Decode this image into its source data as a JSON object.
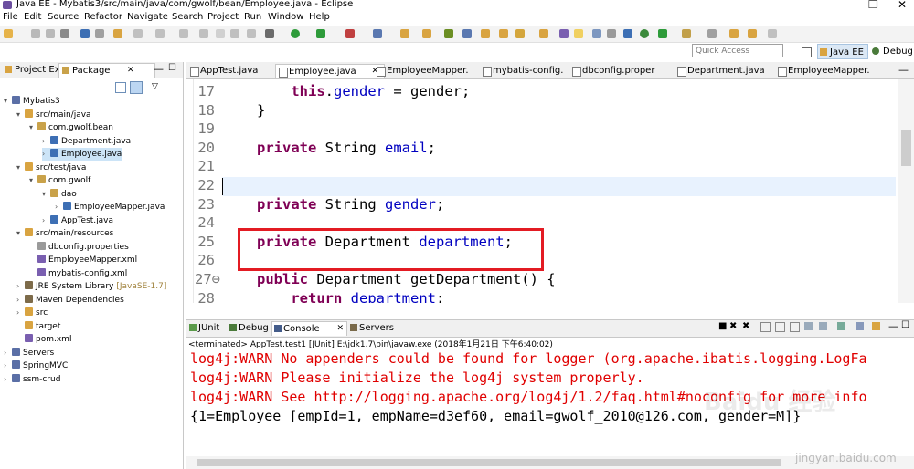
{
  "window": {
    "title": "Java EE - Mybatis3/src/main/java/com/gwolf/bean/Employee.java - Eclipse",
    "controls": [
      "—",
      "❐",
      "✕"
    ]
  },
  "menu": [
    "File",
    "Edit",
    "Source",
    "Refactor",
    "Navigate",
    "Search",
    "Project",
    "Run",
    "Window",
    "Help"
  ],
  "quick_access": {
    "placeholder": "Quick Access"
  },
  "perspectives": {
    "java_ee": "Java EE",
    "debug": "Debug"
  },
  "left_panel": {
    "tabs": [
      "Project Ex",
      "Package"
    ],
    "tree": [
      {
        "label": "Mybatis3",
        "level": 0,
        "arrow": "▾",
        "icon": "project"
      },
      {
        "label": "src/main/java",
        "level": 1,
        "arrow": "▾",
        "icon": "folder"
      },
      {
        "label": "com.gwolf.bean",
        "level": 2,
        "arrow": "▾",
        "icon": "package"
      },
      {
        "label": "Department.java",
        "level": 3,
        "arrow": "›",
        "icon": "java"
      },
      {
        "label": "Employee.java",
        "level": 3,
        "arrow": "›",
        "icon": "java",
        "selected": true
      },
      {
        "label": "src/test/java",
        "level": 1,
        "arrow": "▾",
        "icon": "folder"
      },
      {
        "label": "com.gwolf",
        "level": 2,
        "arrow": "▾",
        "icon": "package"
      },
      {
        "label": "dao",
        "level": 3,
        "arrow": "▾",
        "icon": "package"
      },
      {
        "label": "EmployeeMapper.java",
        "level": 4,
        "arrow": "›",
        "icon": "java"
      },
      {
        "label": "AppTest.java",
        "level": 3,
        "arrow": "›",
        "icon": "java"
      },
      {
        "label": "src/main/resources",
        "level": 1,
        "arrow": "▾",
        "icon": "folder"
      },
      {
        "label": "dbconfig.properties",
        "level": 2,
        "arrow": "",
        "icon": "file"
      },
      {
        "label": "EmployeeMapper.xml",
        "level": 2,
        "arrow": "",
        "icon": "xml"
      },
      {
        "label": "mybatis-config.xml",
        "level": 2,
        "arrow": "",
        "icon": "xml"
      },
      {
        "label": "JRE System Library",
        "suffix": "[JavaSE-1.7]",
        "level": 1,
        "arrow": "›",
        "icon": "lib"
      },
      {
        "label": "Maven Dependencies",
        "level": 1,
        "arrow": "›",
        "icon": "lib"
      },
      {
        "label": "src",
        "level": 1,
        "arrow": "›",
        "icon": "folder"
      },
      {
        "label": "target",
        "level": 1,
        "arrow": "",
        "icon": "folder"
      },
      {
        "label": "pom.xml",
        "level": 1,
        "arrow": "",
        "icon": "xml"
      },
      {
        "label": "Servers",
        "level": 0,
        "arrow": "›",
        "icon": "project"
      },
      {
        "label": "SpringMVC",
        "level": 0,
        "arrow": "›",
        "icon": "project"
      },
      {
        "label": "ssm-crud",
        "level": 0,
        "arrow": "›",
        "icon": "project"
      }
    ]
  },
  "editor_tabs": [
    {
      "label": "AppTest.java",
      "active": false
    },
    {
      "label": "Employee.java",
      "active": true,
      "close": "✕"
    },
    {
      "label": "EmployeeMapper.",
      "active": false
    },
    {
      "label": "mybatis-config.",
      "active": false
    },
    {
      "label": "dbconfig.proper",
      "active": false
    },
    {
      "label": "Department.java",
      "active": false
    },
    {
      "label": "EmployeeMapper.",
      "active": false
    }
  ],
  "code": [
    {
      "ln": "17",
      "tokens": [
        {
          "t": "    "
        },
        {
          "t": "this",
          "c": "kw"
        },
        {
          "t": "."
        },
        {
          "t": "gender",
          "c": "fld"
        },
        {
          "t": " = gender;"
        }
      ]
    },
    {
      "ln": "18",
      "tokens": [
        {
          "t": "}"
        }
      ]
    },
    {
      "ln": "19",
      "tokens": []
    },
    {
      "ln": "20",
      "tokens": [
        {
          "t": "private",
          "c": "kw"
        },
        {
          "t": " String "
        },
        {
          "t": "email",
          "c": "fld"
        },
        {
          "t": ";"
        }
      ]
    },
    {
      "ln": "21",
      "tokens": []
    },
    {
      "ln": "22",
      "tokens": []
    },
    {
      "ln": "23",
      "tokens": [
        {
          "t": "private",
          "c": "kw"
        },
        {
          "t": " String "
        },
        {
          "t": "gender",
          "c": "fld"
        },
        {
          "t": ";"
        }
      ]
    },
    {
      "ln": "24",
      "tokens": []
    },
    {
      "ln": "25",
      "tokens": [
        {
          "t": "private",
          "c": "kw"
        },
        {
          "t": " Department "
        },
        {
          "t": "department",
          "c": "fld"
        },
        {
          "t": ";"
        }
      ]
    },
    {
      "ln": "26",
      "tokens": []
    },
    {
      "ln": "27⊖",
      "tokens": [
        {
          "t": "public",
          "c": "kw"
        },
        {
          "t": " Department getDepartment() {"
        }
      ]
    },
    {
      "ln": "28",
      "tokens": [
        {
          "t": "    "
        },
        {
          "t": "return",
          "c": "kw"
        },
        {
          "t": " "
        },
        {
          "t": "department",
          "c": "fld"
        },
        {
          "t": ";"
        }
      ]
    }
  ],
  "bottom_tabs": [
    {
      "label": "JUnit",
      "active": false
    },
    {
      "label": "Debug",
      "active": false
    },
    {
      "label": "Console",
      "active": true,
      "close": "✕"
    },
    {
      "label": "Servers",
      "active": false
    }
  ],
  "console": {
    "terminated": "<terminated> AppTest.test1 [JUnit] E:\\jdk1.7\\bin\\javaw.exe (2018年1月21日 下午6:40:02)",
    "lines": [
      {
        "text": "log4j:WARN No appenders could be found for logger (org.apache.ibatis.logging.LogFa",
        "type": "err"
      },
      {
        "text": "log4j:WARN Please initialize the log4j system properly.",
        "type": "err"
      },
      {
        "text": "log4j:WARN See http://logging.apache.org/log4j/1.2/faq.html#noconfig for more info",
        "type": "err"
      },
      {
        "text": "{1=Employee [empId=1, empName=d3ef60, email=gwolf_2010@126.com, gender=M]}",
        "type": "out"
      }
    ]
  },
  "watermark": {
    "big": "Baidu 经验",
    "small": "jingyan.baidu.com"
  },
  "colors": {
    "keyword": "#7f0055",
    "field": "#0000c0",
    "error": "#e00000",
    "highlight_box": "#e31b23"
  }
}
